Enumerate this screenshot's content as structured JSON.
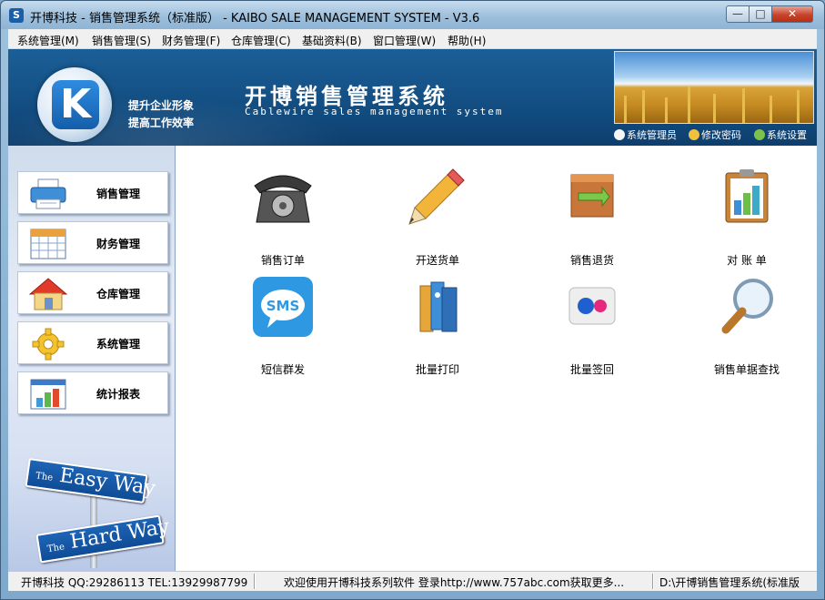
{
  "window": {
    "title": "开博科技 - 销售管理系统（标准版） - KAIBO SALE MANAGEMENT SYSTEM - V3.6",
    "controls": {
      "minimize": "—",
      "maximize": "□",
      "close": "✕"
    }
  },
  "menubar": [
    "系统管理(M)",
    "销售管理(S)",
    "财务管理(F)",
    "仓库管理(C)",
    "基础资料(B)",
    "窗口管理(W)",
    "帮助(H)"
  ],
  "banner": {
    "logo_letter": "K",
    "slogan_line1": "提升企业形象",
    "slogan_line2": "提高工作效率",
    "title": "开博销售管理系统",
    "subtitle": "Cablewire sales management system",
    "top_links": [
      "系统管理员",
      "修改密码",
      "系统设置"
    ]
  },
  "sidebar": {
    "items": [
      {
        "label": "销售管理",
        "icon": "printer-icon"
      },
      {
        "label": "财务管理",
        "icon": "calendar-grid-icon"
      },
      {
        "label": "仓库管理",
        "icon": "house-icon"
      },
      {
        "label": "系统管理",
        "icon": "gear-icon"
      },
      {
        "label": "统计报表",
        "icon": "bar-chart-icon"
      }
    ],
    "signs": {
      "easy_small": "The",
      "easy": "Easy Way",
      "hard_small": "The",
      "hard": "Hard Way"
    }
  },
  "tiles": [
    {
      "label": "销售订单",
      "icon": "telephone-icon"
    },
    {
      "label": "开送货单",
      "icon": "pencil-icon"
    },
    {
      "label": "销售退货",
      "icon": "return-arrows-icon"
    },
    {
      "label": "对 账 单",
      "icon": "clipboard-chart-icon"
    },
    {
      "label": "短信群发",
      "icon": "sms-icon",
      "icon_text": "SMS"
    },
    {
      "label": "批量打印",
      "icon": "binders-icon"
    },
    {
      "label": "批量签回",
      "icon": "dots-icon"
    },
    {
      "label": "销售单据查找",
      "icon": "magnifier-icon"
    }
  ],
  "statusbar": [
    "开博科技 QQ:29286113 TEL:13929987799",
    "欢迎使用开博科技系列软件  登录http://www.757abc.com获取更多...",
    "D:\\开博销售管理系统(标准版"
  ]
}
